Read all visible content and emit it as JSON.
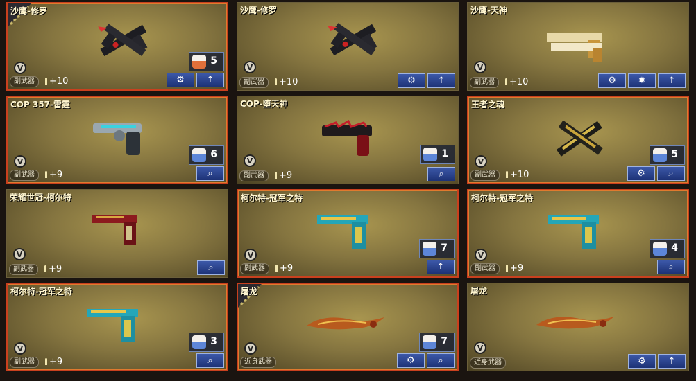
{
  "cards": [
    {
      "title": "沙鹰-修罗",
      "type": "副武器",
      "ammo": "+10",
      "count": "5",
      "chest": "orange",
      "buttons": [
        "settings",
        "upgrade"
      ],
      "corner": true,
      "selected": true,
      "gun": "dual-black-red"
    },
    {
      "title": "沙鹰-修罗",
      "type": "副武器",
      "ammo": "+10",
      "count": "",
      "chest": "",
      "buttons": [
        "settings",
        "upgrade"
      ],
      "corner": false,
      "selected": false,
      "gun": "dual-black-red"
    },
    {
      "title": "沙鹰-天神",
      "type": "副武器",
      "ammo": "+10",
      "count": "",
      "chest": "",
      "buttons": [
        "settings",
        "gear",
        "upgrade"
      ],
      "corner": false,
      "selected": false,
      "gun": "dual-gold"
    },
    {
      "title": "COP 357-雷霆",
      "type": "副武器",
      "ammo": "+9",
      "count": "6",
      "chest": "blue",
      "buttons": [
        "search"
      ],
      "corner": false,
      "selected": true,
      "gun": "revolver-silver"
    },
    {
      "title": "COP-堕天神",
      "type": "副武器",
      "ammo": "+9",
      "count": "1",
      "chest": "blue",
      "buttons": [
        "search"
      ],
      "corner": false,
      "selected": false,
      "gun": "revolver-black-red"
    },
    {
      "title": "王者之魂",
      "type": "副武器",
      "ammo": "+10",
      "count": "5",
      "chest": "blue",
      "buttons": [
        "settings",
        "search"
      ],
      "corner": false,
      "selected": true,
      "gun": "dual-gold-black"
    },
    {
      "title": "荣耀世冠-柯尔特",
      "type": "副武器",
      "ammo": "+9",
      "count": "",
      "chest": "",
      "buttons": [
        "search"
      ],
      "corner": false,
      "selected": false,
      "gun": "pistol-red"
    },
    {
      "title": "柯尔特-冠军之特",
      "type": "副武器",
      "ammo": "+9",
      "count": "7",
      "chest": "blue",
      "buttons": [
        "upgrade"
      ],
      "corner": false,
      "selected": true,
      "gun": "pistol-teal"
    },
    {
      "title": "柯尔特-冠军之特",
      "type": "副武器",
      "ammo": "+9",
      "count": "4",
      "chest": "blue",
      "buttons": [
        "search"
      ],
      "corner": false,
      "selected": true,
      "gun": "pistol-teal"
    },
    {
      "title": "柯尔特-冠军之特",
      "type": "副武器",
      "ammo": "+9",
      "count": "3",
      "chest": "blue",
      "buttons": [
        "search"
      ],
      "corner": false,
      "selected": true,
      "gun": "pistol-teal"
    },
    {
      "title": "屠龙",
      "type": "近身武器",
      "ammo": "",
      "count": "7",
      "chest": "blue",
      "buttons": [
        "settings",
        "search"
      ],
      "corner": true,
      "selected": true,
      "gun": "blade"
    },
    {
      "title": "屠龙",
      "type": "近身武器",
      "ammo": "",
      "count": "",
      "chest": "",
      "buttons": [
        "settings",
        "upgrade"
      ],
      "corner": false,
      "selected": false,
      "gun": "blade"
    }
  ],
  "colors": {
    "accent_border": "#c9401e",
    "button": "#2a4390",
    "orange_chest": "#e0703a",
    "blue_chest": "#5d86d8"
  }
}
